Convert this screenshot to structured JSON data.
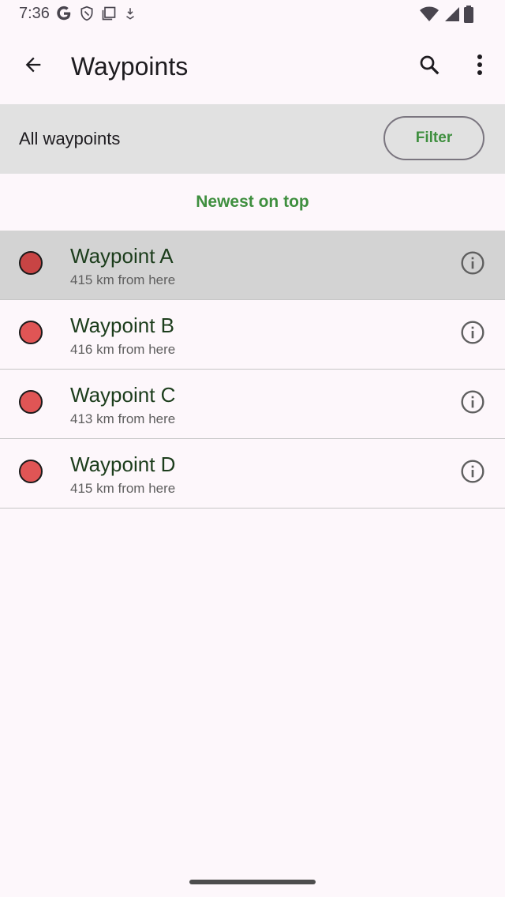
{
  "status_bar": {
    "time": "7:36",
    "left_icons": [
      "google-icon",
      "shield-icon",
      "screen-icon",
      "download-icon"
    ],
    "right_icons": [
      "wifi-icon",
      "signal-icon",
      "battery-icon"
    ]
  },
  "app_bar": {
    "title": "Waypoints",
    "back_icon": "arrow-back-icon",
    "search_icon": "search-icon",
    "more_icon": "more-vert-icon"
  },
  "filter_bar": {
    "label": "All waypoints",
    "button_label": "Filter"
  },
  "sort_label": "Newest on top",
  "waypoints": [
    {
      "name": "Waypoint A",
      "distance": "415 km from here",
      "selected": true
    },
    {
      "name": "Waypoint B",
      "distance": "416 km from here",
      "selected": false
    },
    {
      "name": "Waypoint C",
      "distance": "413 km from here",
      "selected": false
    },
    {
      "name": "Waypoint D",
      "distance": "415 km from here",
      "selected": false
    }
  ],
  "colors": {
    "accent": "#3f8f3f",
    "marker": "#e05555",
    "marker_selected": "#c84444",
    "title_text": "#1c3d1c",
    "filter_bar_bg": "#e1e1e1",
    "selected_row_bg": "#d3d3d3",
    "background": "#fdf7fb"
  }
}
